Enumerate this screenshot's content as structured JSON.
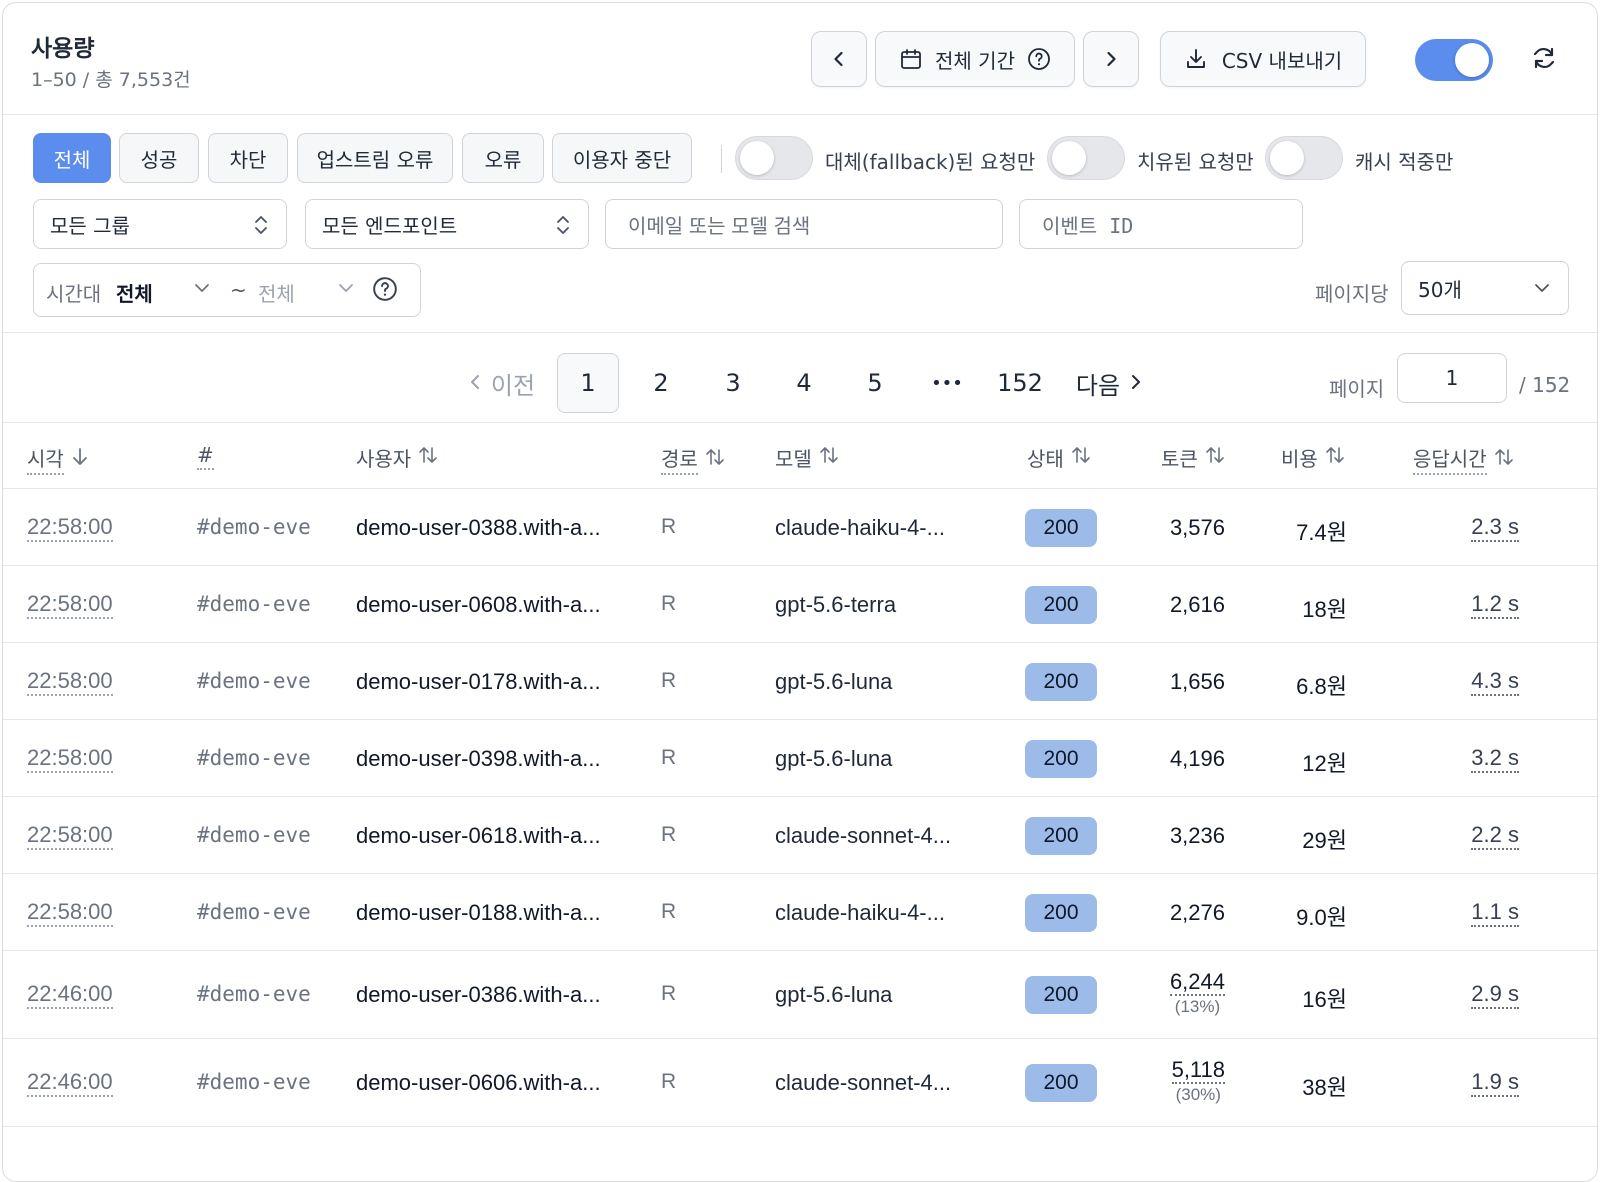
{
  "header": {
    "title": "사용량",
    "subtitle": "1–50 / 총 7,553건",
    "period_label": "전체 기간",
    "csv_label": "CSV 내보내기"
  },
  "filters": {
    "chips": [
      "전체",
      "성공",
      "차단",
      "업스트림 오류",
      "오류",
      "이용자 중단"
    ],
    "active_chip": "전체",
    "toggles": [
      "대체(fallback)된 요청만",
      "치유된 요청만",
      "캐시 적중만"
    ],
    "group_select": "모든 그룹",
    "endpoint_select": "모든 엔드포인트",
    "search_placeholder": "이메일 또는 모델 검색",
    "event_id_placeholder": "이벤트 ID",
    "timezone_label": "시간대",
    "timezone_from": "전체",
    "timezone_sep": "~",
    "timezone_to": "전체",
    "per_page_label": "페이지당",
    "per_page_value": "50개"
  },
  "pagination": {
    "prev_label": "이전",
    "pages": [
      "1",
      "2",
      "3",
      "4",
      "5"
    ],
    "ellipsis": "•••",
    "last_page": "152",
    "next_label": "다음",
    "current_page": "1",
    "page_label": "페이지",
    "page_input": "1",
    "total_pages": "/ 152"
  },
  "table": {
    "columns": {
      "time": "시각",
      "id": "#",
      "user": "사용자",
      "route": "경로",
      "model": "모델",
      "status": "상태",
      "tokens": "토큰",
      "cost": "비용",
      "latency": "응답시간"
    },
    "rows": [
      {
        "time": "22:58:00",
        "id": "#demo-eve",
        "user": "demo-user-0388.with-a...",
        "route": "R",
        "model": "claude-haiku-4-...",
        "status": "200",
        "tokens": "3,576",
        "token_pct": "",
        "cost": "7.4원",
        "latency": "2.3 s"
      },
      {
        "time": "22:58:00",
        "id": "#demo-eve",
        "user": "demo-user-0608.with-a...",
        "route": "R",
        "model": "gpt-5.6-terra",
        "status": "200",
        "tokens": "2,616",
        "token_pct": "",
        "cost": "18원",
        "latency": "1.2 s"
      },
      {
        "time": "22:58:00",
        "id": "#demo-eve",
        "user": "demo-user-0178.with-a...",
        "route": "R",
        "model": "gpt-5.6-luna",
        "status": "200",
        "tokens": "1,656",
        "token_pct": "",
        "cost": "6.8원",
        "latency": "4.3 s"
      },
      {
        "time": "22:58:00",
        "id": "#demo-eve",
        "user": "demo-user-0398.with-a...",
        "route": "R",
        "model": "gpt-5.6-luna",
        "status": "200",
        "tokens": "4,196",
        "token_pct": "",
        "cost": "12원",
        "latency": "3.2 s"
      },
      {
        "time": "22:58:00",
        "id": "#demo-eve",
        "user": "demo-user-0618.with-a...",
        "route": "R",
        "model": "claude-sonnet-4...",
        "status": "200",
        "tokens": "3,236",
        "token_pct": "",
        "cost": "29원",
        "latency": "2.2 s"
      },
      {
        "time": "22:58:00",
        "id": "#demo-eve",
        "user": "demo-user-0188.with-a...",
        "route": "R",
        "model": "claude-haiku-4-...",
        "status": "200",
        "tokens": "2,276",
        "token_pct": "",
        "cost": "9.0원",
        "latency": "1.1 s"
      },
      {
        "time": "22:46:00",
        "id": "#demo-eve",
        "user": "demo-user-0386.with-a...",
        "route": "R",
        "model": "gpt-5.6-luna",
        "status": "200",
        "tokens": "6,244",
        "token_pct": "(13%)",
        "cost": "16원",
        "latency": "2.9 s"
      },
      {
        "time": "22:46:00",
        "id": "#demo-eve",
        "user": "demo-user-0606.with-a...",
        "route": "R",
        "model": "claude-sonnet-4...",
        "status": "200",
        "tokens": "5,118",
        "token_pct": "(30%)",
        "cost": "38원",
        "latency": "1.9 s"
      }
    ]
  },
  "colors": {
    "accent": "#5b8def",
    "status_badge": "#9cbbe9",
    "border": "#d9dde3"
  },
  "icons": [
    "chevron-left-icon",
    "calendar-icon",
    "help-circle-icon",
    "chevron-right-icon",
    "download-icon",
    "refresh-icon",
    "chevron-updown-icon",
    "chevron-down-icon",
    "sort-arrow-icon"
  ]
}
